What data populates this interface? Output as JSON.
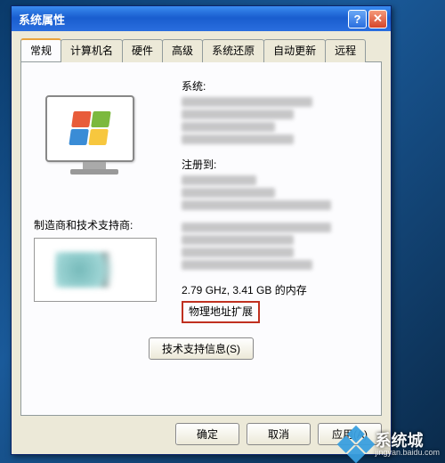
{
  "window": {
    "title": "系统属性",
    "help_glyph": "?",
    "close_glyph": "✕"
  },
  "tabs": {
    "general": "常规",
    "computer_name": "计算机名",
    "hardware": "硬件",
    "advanced": "高级",
    "system_restore": "系统还原",
    "auto_update": "自动更新",
    "remote": "远程"
  },
  "sections": {
    "system": "系统:",
    "registered": "注册到:",
    "oem": "制造商和技术支持商:"
  },
  "specs": {
    "line": "2.79 GHz, 3.41 GB 的内存",
    "pae": "物理地址扩展"
  },
  "buttons": {
    "support": "技术支持信息(S)",
    "ok": "确定",
    "cancel": "取消",
    "apply": "应用(A)"
  },
  "watermark": {
    "main": "系统城",
    "sub": "jingyan.baidu.com"
  }
}
